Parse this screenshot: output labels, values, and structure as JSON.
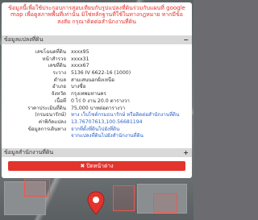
{
  "notice": {
    "text": "ข้อมูลนี้เพื่อใช้ประกอบการสอบเทียบกับรูปแปลงที่ดินร่วมกับแผนที่ google map เพื่อดูสภาพพื้นที่เท่านั้น มิใช่หลักฐานที่ใช้ในทางกฎหมาย หากมีข้อสงสัย กรุณาติดต่อสำนักงานที่ดิน"
  },
  "parcel_section": {
    "title": "ข้อมูลแปลงที่ดิน",
    "toggle": "−",
    "rows": [
      {
        "label": "เลขโฉนดที่ดิน",
        "value": "xxxx95"
      },
      {
        "label": "หน้าสำรวจ",
        "value": "xxxx31"
      },
      {
        "label": "เลขที่ดิน",
        "value": "xxxx67"
      },
      {
        "label": "ระวาง",
        "value": "5136 IV 6622-16 (1000)"
      },
      {
        "label": "ตำบล",
        "value": "สามเสนนอกฝั่งเหนือ"
      },
      {
        "label": "อำเภอ",
        "value": "บางซื่อ"
      },
      {
        "label": "จังหวัด",
        "value": "กรุงเทพมหานคร"
      },
      {
        "label": "เนื้อที่",
        "value": "0 ไร่ 0 งาน 20.0 ตารางวา"
      },
      {
        "label": "ราคาประเมินที่ดิน",
        "value": "75,000 บาทต่อตารางวา",
        "link": false
      },
      {
        "label": "(กรมธนารักษ์)",
        "value": "ทาง เว็บไซต์กรมธนารักษ์ หรือติดต่อสำนักงานที่ดิน",
        "link": true
      },
      {
        "label": "ค่าพิกัดแปลง",
        "value": "13.76707613,100.56681194",
        "link": true
      },
      {
        "label": "ข้อมูลการเดินทาง",
        "value": "จากที่ตั้งที่ดินไปยังที่ดิน",
        "link": true
      },
      {
        "label": "",
        "value": "จากแปลงที่ดินไปยังสำนักงานที่ดิน",
        "link": true
      }
    ]
  },
  "office_section": {
    "title": "ข้อมูลสำนักงานที่ดิน",
    "toggle": "+"
  },
  "close_button": {
    "label": "✖ ปิดหน้าต่าง"
  },
  "colors": {
    "notice": "#e2312b",
    "header_bg": "#d9d9d9",
    "link": "#2b63c9",
    "close_bg": "#e2342d"
  }
}
